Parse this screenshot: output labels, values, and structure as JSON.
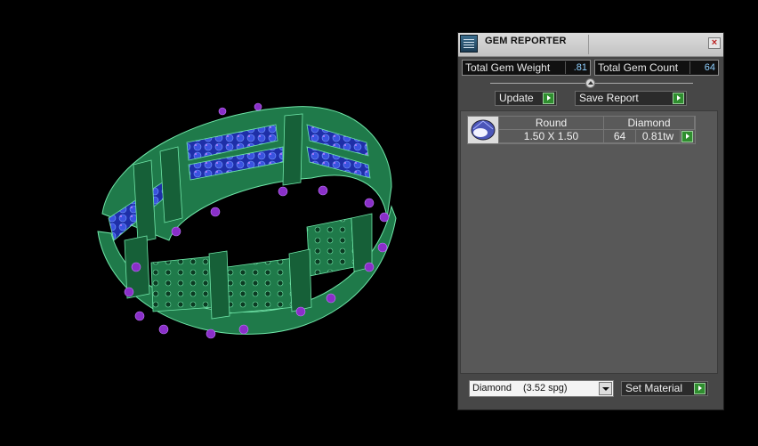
{
  "panel": {
    "title": "GEM REPORTER",
    "close_glyph": "×",
    "icons": {
      "app": "gem-reporter-app-icon",
      "close": "close-icon",
      "go": "green-play-icon",
      "gem": "round-gem-icon",
      "dropdown": "chevron-down-icon"
    },
    "stats": {
      "weight_label": "Total Gem Weight",
      "weight_value": ".81",
      "count_label": "Total Gem Count",
      "count_value": "64"
    },
    "buttons": {
      "update": "Update",
      "save_report": "Save Report",
      "set_material": "Set Material"
    },
    "gem_table": {
      "rows": [
        {
          "shape": "Round",
          "material": "Diamond",
          "size": "1.50 X 1.50",
          "count": "64",
          "weight": "0.81tw"
        }
      ]
    },
    "material_select": {
      "selected_name": "Diamond",
      "selected_spg": "(3.52 spg)"
    }
  },
  "colors": {
    "ring_metal": "#1f7a4a",
    "ring_edge": "#6fe6a8",
    "gem_blue": "#2a3fd0",
    "prong_purple": "#8a2fc9",
    "background": "#000000"
  }
}
